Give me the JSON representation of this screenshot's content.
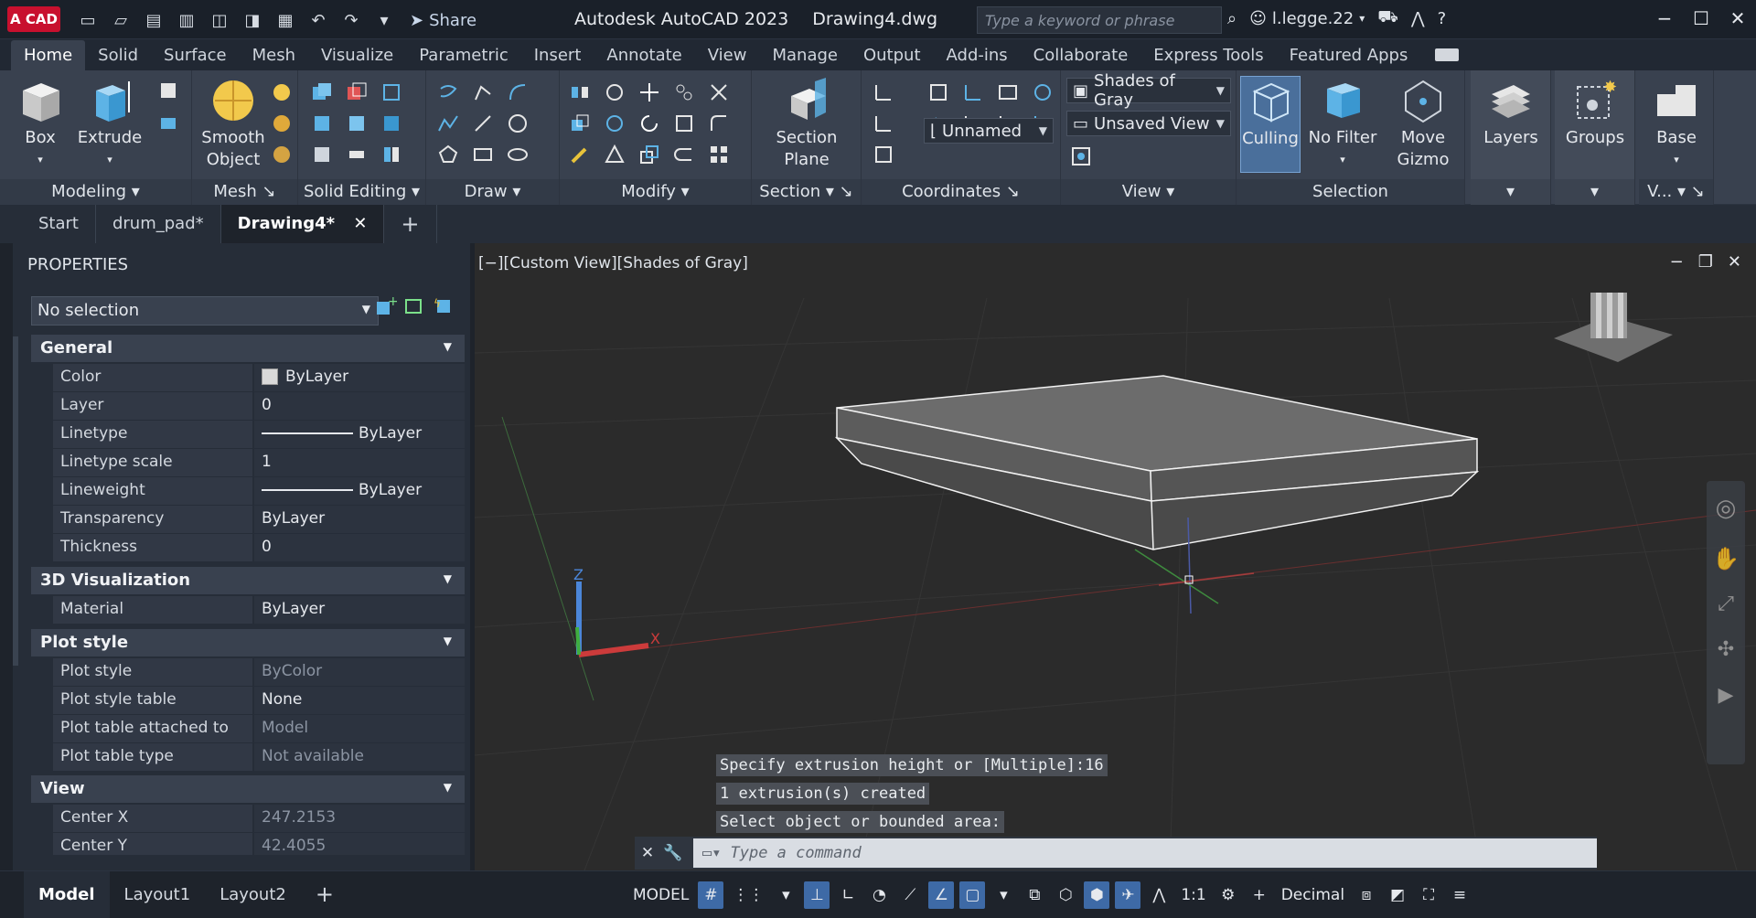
{
  "titlebar": {
    "logo": "A CAD",
    "share": "Share",
    "app_title": "Autodesk AutoCAD 2023",
    "doc_title": "Drawing4.dwg",
    "search_placeholder": "Type a keyword or phrase",
    "user": "l.legge.22"
  },
  "menu": [
    "Home",
    "Solid",
    "Surface",
    "Mesh",
    "Visualize",
    "Parametric",
    "Insert",
    "Annotate",
    "View",
    "Manage",
    "Output",
    "Add-ins",
    "Collaborate",
    "Express Tools",
    "Featured Apps"
  ],
  "ribbon": {
    "box": "Box",
    "extrude": "Extrude",
    "smooth_object": "Smooth Object",
    "section_plane": "Section Plane",
    "culling": "Culling",
    "no_filter": "No Filter",
    "move_gizmo": "Move Gizmo",
    "layers": "Layers",
    "groups": "Groups",
    "base": "Base",
    "visual_style": "Shades of Gray",
    "view": "Unsaved View",
    "ucs": "Unnamed",
    "panels": {
      "modeling": "Modeling",
      "mesh": "Mesh",
      "solid_editing": "Solid Editing",
      "draw": "Draw",
      "modify": "Modify",
      "section": "Section",
      "coordinates": "Coordinates",
      "view": "View",
      "selection": "Selection",
      "v": "V..."
    }
  },
  "doc_tabs": [
    "Start",
    "drum_pad*",
    "Drawing4*"
  ],
  "properties": {
    "title": "PROPERTIES",
    "selection": "No selection",
    "sections": {
      "general": "General",
      "viz3d": "3D Visualization",
      "plot": "Plot style",
      "view": "View"
    },
    "general": [
      {
        "k": "Color",
        "v": "ByLayer"
      },
      {
        "k": "Layer",
        "v": "0"
      },
      {
        "k": "Linetype",
        "v": "ByLayer"
      },
      {
        "k": "Linetype scale",
        "v": "1"
      },
      {
        "k": "Lineweight",
        "v": "ByLayer"
      },
      {
        "k": "Transparency",
        "v": "ByLayer"
      },
      {
        "k": "Thickness",
        "v": "0"
      }
    ],
    "viz3d": [
      {
        "k": "Material",
        "v": "ByLayer"
      }
    ],
    "plot": [
      {
        "k": "Plot style",
        "v": "ByColor"
      },
      {
        "k": "Plot style table",
        "v": "None"
      },
      {
        "k": "Plot table attached to",
        "v": "Model"
      },
      {
        "k": "Plot table type",
        "v": "Not available"
      }
    ],
    "view": [
      {
        "k": "Center X",
        "v": "247.2153"
      },
      {
        "k": "Center Y",
        "v": "42.4055"
      }
    ]
  },
  "viewport": {
    "label": "[−][Custom View][Shades of Gray]",
    "history": [
      "Specify extrusion height or [Multiple]:16",
      "1 extrusion(s) created",
      "Select object or bounded area:"
    ],
    "command_placeholder": "Type a command"
  },
  "status": {
    "layouts": [
      "Model",
      "Layout1",
      "Layout2"
    ],
    "model": "MODEL",
    "scale": "1:1",
    "units": "Decimal"
  }
}
